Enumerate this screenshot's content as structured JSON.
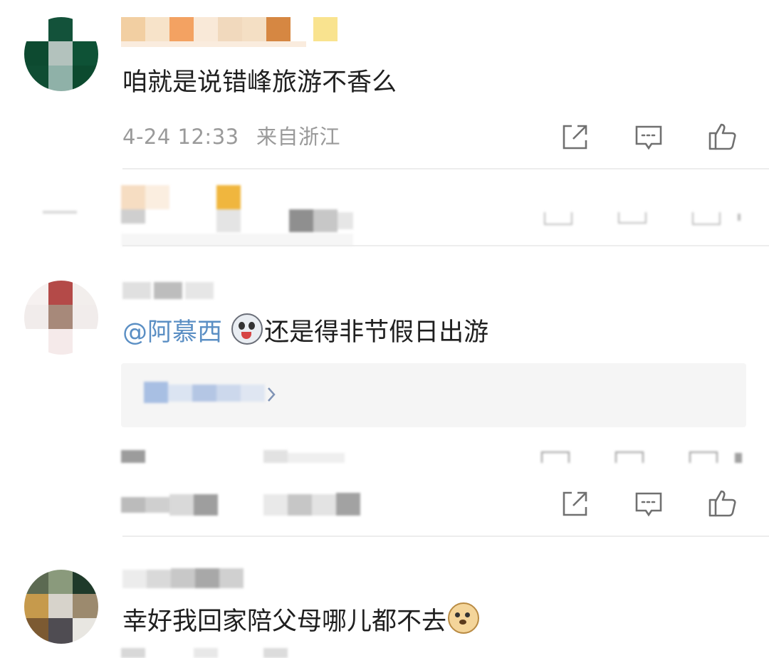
{
  "comments": [
    {
      "text": "咱就是说错峰旅游不香么",
      "time": "4-24 12:33",
      "location": "来自浙江"
    },
    {
      "mention": "@阿慕西",
      "text": "还是得非节假日出游"
    },
    {
      "text": "幸好我回家陪父母哪儿都不去"
    }
  ],
  "icons": {
    "share": "share-icon",
    "comment": "comment-icon",
    "like": "like-icon"
  },
  "colors": {
    "mention": "#5b8fc4",
    "meta": "#9a9a9a",
    "reply_bg": "#f5f5f5"
  }
}
